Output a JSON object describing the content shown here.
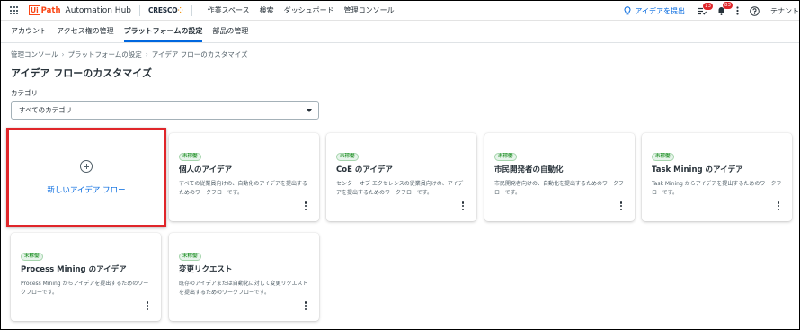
{
  "header": {
    "logo_ui": "Ui",
    "logo_path": "Path",
    "app_name": "Automation Hub",
    "org_name": "CRESCO",
    "nav": [
      "作業スペース",
      "検索",
      "ダッシュボード",
      "管理コンソール"
    ],
    "submit_idea": "アイデアを提出",
    "tasks_count": "13",
    "notifications_count": "83",
    "tenant": "テナント"
  },
  "subnav": {
    "tabs": [
      "アカウント",
      "アクセス権の管理",
      "プラットフォームの設定",
      "部品の管理"
    ],
    "active_tab": "プラットフォームの設定"
  },
  "breadcrumb": [
    "管理コンソール",
    "プラットフォームの設定",
    "アイデア フローのカスタマイズ"
  ],
  "page_title": "アイデア フローのカスタマイズ",
  "category": {
    "label": "カテゴリ",
    "selected": "すべてのカテゴリ"
  },
  "new_flow": {
    "label": "新しいアイデア フロー"
  },
  "flows": [
    {
      "status": "未稼働",
      "title": "個人のアイデア",
      "description": "すべての従業員向けの、自動化のアイデアを提出するためのワークフローです。"
    },
    {
      "status": "未稼働",
      "title": "CoE のアイデア",
      "description": "センター オブ エクセレンスの従業員向けの、アイデアを提出するためのワークフローです。"
    },
    {
      "status": "未稼働",
      "title": "市民開発者の自動化",
      "description": "市民開発者向けの、自動化を提出するためのワークフローです。"
    },
    {
      "status": "未稼働",
      "title": "Task Mining のアイデア",
      "description": "Task Mining からアイデアを提出するためのワークフローです。"
    },
    {
      "status": "未稼働",
      "title": "Process Mining のアイデア",
      "description": "Process Mining からアイデアを提出するためのワークフローです。"
    },
    {
      "status": "未稼働",
      "title": "変更リクエスト",
      "description": "既存のアイデアまたは自動化に対して変更リクエストを提出するためのワークフローです。"
    }
  ],
  "colors": {
    "accent": "#0067df",
    "brand": "#fa4616",
    "highlight_border": "#e0262a",
    "status_green": "#038108"
  }
}
